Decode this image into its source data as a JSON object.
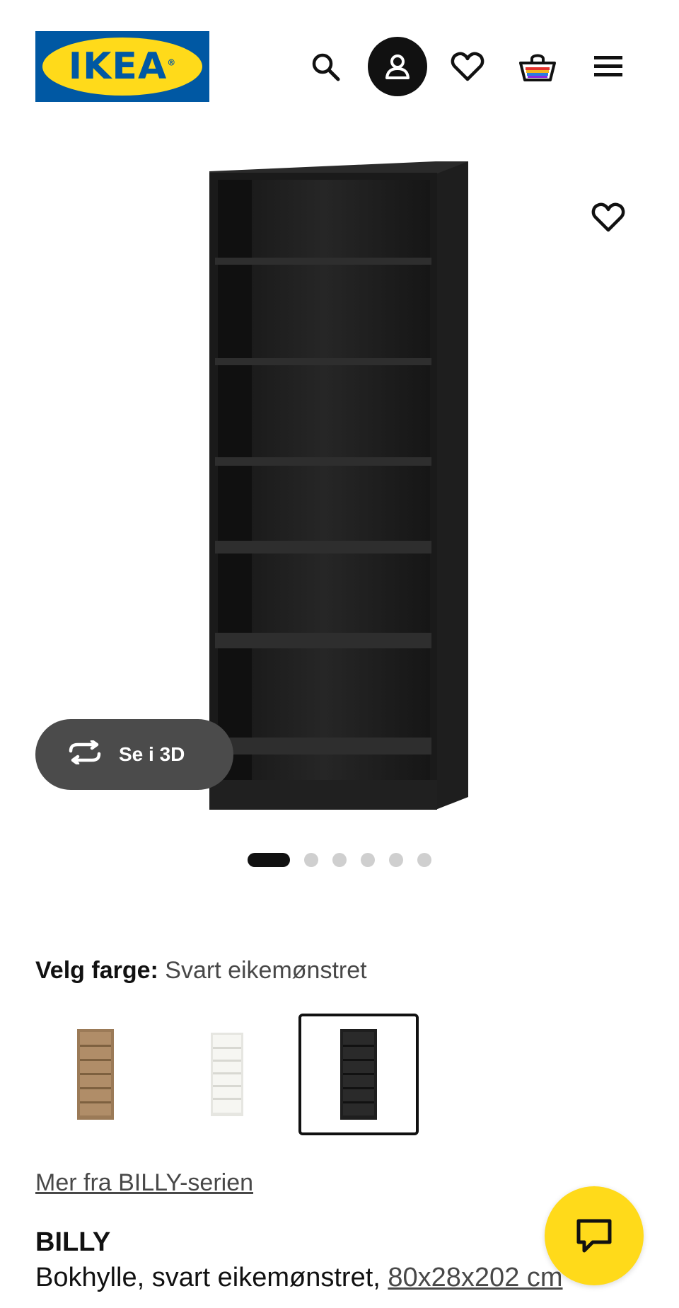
{
  "header": {
    "logo_text": "IKEA",
    "logo_mark": "®",
    "icons": [
      "search-icon",
      "user-icon",
      "heart-icon",
      "basket-icon",
      "hamburger-menu-icon"
    ]
  },
  "gallery": {
    "view_3d_label": "Se i 3D",
    "dots_count": 6,
    "active_dot": 1
  },
  "color_picker": {
    "label": "Velg farge:",
    "selected_value": "Svart eikemønstret",
    "options": [
      "brown",
      "white",
      "black"
    ]
  },
  "series_link": "Mer fra BILLY-serien",
  "product": {
    "name": "BILLY",
    "description": "Bokhylle, svart eikemønstret, ",
    "dimensions": "80x28x202 cm"
  },
  "colors": {
    "ikea_blue": "#0058a3",
    "ikea_yellow": "#ffda1a",
    "dark_button": "#4b4b4b"
  }
}
